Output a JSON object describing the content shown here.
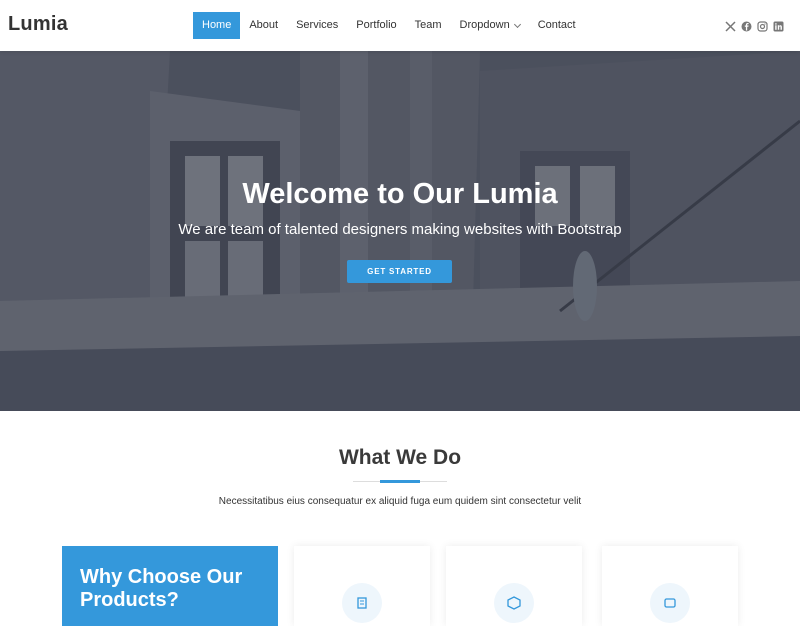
{
  "header": {
    "logo": "Lumia",
    "nav": [
      {
        "label": "Home",
        "active": true
      },
      {
        "label": "About"
      },
      {
        "label": "Services"
      },
      {
        "label": "Portfolio"
      },
      {
        "label": "Team"
      },
      {
        "label": "Dropdown",
        "has_chevron": true
      },
      {
        "label": "Contact"
      }
    ],
    "social_icons": [
      "x-icon",
      "facebook-icon",
      "instagram-icon",
      "linkedin-icon"
    ]
  },
  "hero": {
    "title": "Welcome to Our Lumia",
    "subtitle": "We are team of talented designers making websites with Bootstrap",
    "button_label": "GET STARTED"
  },
  "what_we_do": {
    "title": "What We Do",
    "description": "Necessitatibus eius consequatur ex aliquid fuga eum quidem sint consectetur velit"
  },
  "why_box": {
    "title": "Why Choose Our Products?"
  },
  "cards": [
    {
      "icon": "receipt-icon"
    },
    {
      "icon": "cube-icon"
    },
    {
      "icon": "images-icon"
    }
  ],
  "colors": {
    "accent": "#3498db",
    "text_dark": "#333333"
  }
}
